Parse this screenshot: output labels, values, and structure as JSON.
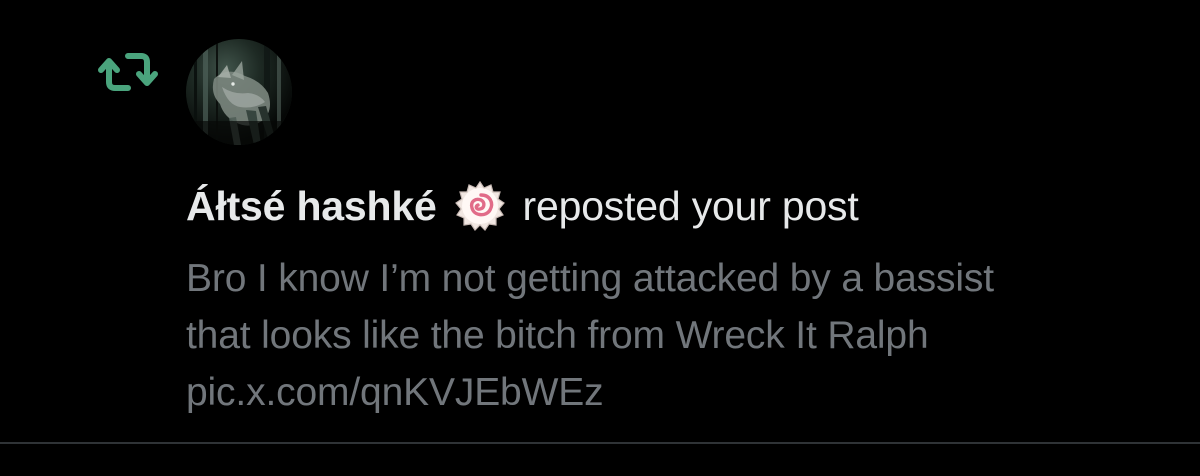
{
  "notification": {
    "type_icon": "repost-icon",
    "avatar_icon": "dark-forest-deer-avatar",
    "user_name": "Áłtsé hashké",
    "emoji_icon": "fish-cake-swirl-emoji-icon",
    "action_text": "reposted your post",
    "post_lines": [
      "Bro I know I’m not getting attacked by a bassist",
      "that looks like the bitch from Wreck It Ralph",
      "pic.x.com/qnKVJEbWEz"
    ]
  },
  "colors": {
    "background": "#000000",
    "repost_green": "#4aa47d",
    "primary_text": "#e7e9ea",
    "secondary_text": "#71767b",
    "divider": "#2f3336"
  }
}
